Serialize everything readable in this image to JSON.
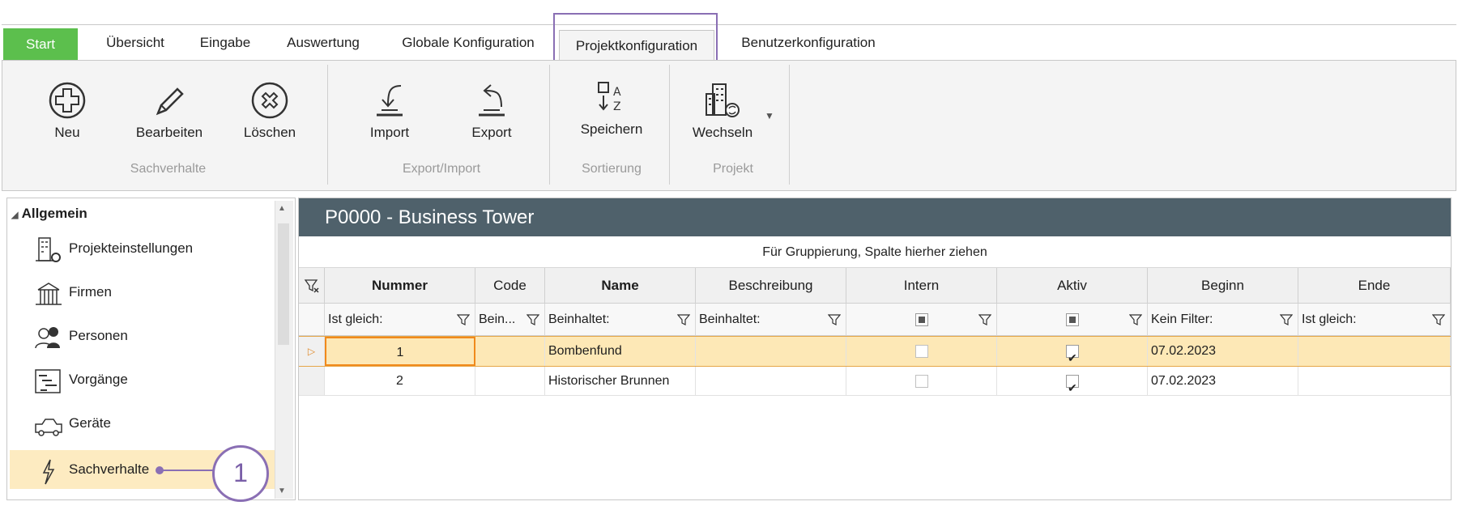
{
  "ribbon": {
    "tabs": [
      "Start",
      "Übersicht",
      "Eingabe",
      "Auswertung",
      "Globale Konfiguration",
      "Projektkonfiguration",
      "Benutzerkonfiguration"
    ],
    "groups": {
      "sachverhalte": {
        "label": "Sachverhalte",
        "buttons": [
          "Neu",
          "Bearbeiten",
          "Löschen"
        ]
      },
      "export_import": {
        "label": "Export/Import",
        "buttons": [
          "Import",
          "Export"
        ]
      },
      "sortierung": {
        "label": "Sortierung",
        "buttons": [
          "Speichern"
        ]
      },
      "projekt": {
        "label": "Projekt",
        "buttons": [
          "Wechseln"
        ]
      }
    }
  },
  "nav": {
    "section": "Allgemein",
    "items": [
      {
        "label": "Projekteinstellungen",
        "icon": "building-gear-icon"
      },
      {
        "label": "Firmen",
        "icon": "companies-icon"
      },
      {
        "label": "Personen",
        "icon": "persons-icon"
      },
      {
        "label": "Vorgänge",
        "icon": "processes-icon"
      },
      {
        "label": "Geräte",
        "icon": "truck-icon"
      },
      {
        "label": "Sachverhalte",
        "icon": "lightning-icon"
      }
    ]
  },
  "project_title": "P0000 - Business Tower",
  "group_hint": "Für Gruppierung, Spalte hierher ziehen",
  "grid": {
    "columns": [
      "Nummer",
      "Code",
      "Name",
      "Beschreibung",
      "Intern",
      "Aktiv",
      "Beginn",
      "Ende"
    ],
    "filters": [
      "Ist gleich:",
      "Bein...",
      "Beinhaltet:",
      "Beinhaltet:",
      "",
      "",
      "Kein Filter:",
      "Ist gleich:"
    ],
    "rows": [
      {
        "nummer": "1",
        "code": "",
        "name": "Bombenfund",
        "beschreibung": "",
        "intern": false,
        "aktiv": true,
        "beginn": "07.02.2023",
        "ende": ""
      },
      {
        "nummer": "2",
        "code": "",
        "name": "Historischer Brunnen",
        "beschreibung": "",
        "intern": false,
        "aktiv": true,
        "beginn": "07.02.2023",
        "ende": ""
      }
    ]
  },
  "callout": "1",
  "colors": {
    "start_tab": "#5cbf4d",
    "header": "#4f616b",
    "highlight": "#8a6fb4",
    "selected_row": "#fde8b6"
  }
}
